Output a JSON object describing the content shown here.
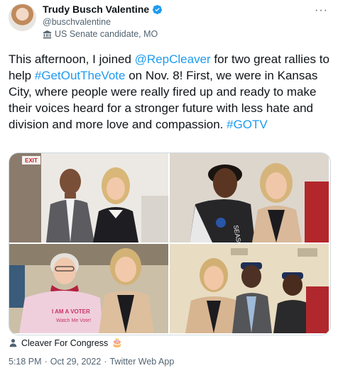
{
  "author": {
    "display_name": "Trudy Busch Valentine",
    "handle": "@buschvalentine",
    "label": "US Senate candidate, MO",
    "verified_icon": "verified-badge-icon",
    "avatar_icon": "avatar"
  },
  "more_label": "···",
  "tweet": {
    "parts": [
      {
        "text": "This afternoon, I joined ",
        "link": false
      },
      {
        "text": "@RepCleaver",
        "link": true
      },
      {
        "text": " for two great rallies to help ",
        "link": false
      },
      {
        "text": "#GetOutTheVote",
        "link": true
      },
      {
        "text": " on Nov. 8! First, we were in Kansas City, where people were really fired up and ready to make their voices heard for a stronger future with less hate and division and more love and compassion. ",
        "link": false
      },
      {
        "text": "#GOTV",
        "link": true
      }
    ]
  },
  "media": {
    "photo_1_sign": "EXIT",
    "photo_3_shirt": "I AM A VOTER",
    "photo_3_shirt_sub": "Watch Me Vote!",
    "photo_2_shirt": "SEASON"
  },
  "tagged": {
    "label": "Cleaver For Congress",
    "emoji": "🎂"
  },
  "meta": {
    "time": "5:18 PM",
    "separator": "·",
    "date": "Oct 29, 2022",
    "separator2": "·",
    "source": "Twitter Web App"
  },
  "colors": {
    "link": "#1d9bf0",
    "secondary_text": "#536471",
    "verified": "#1d9bf0"
  }
}
